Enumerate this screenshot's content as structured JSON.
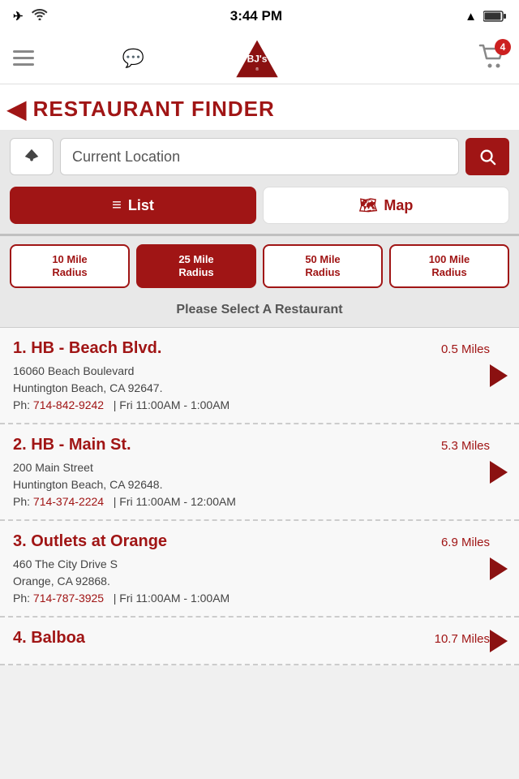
{
  "status": {
    "time": "3:44 PM",
    "battery_label": "🔋",
    "signal": "▲"
  },
  "nav": {
    "menu_label": "Menu",
    "chat_label": "Messages",
    "cart_badge": "4",
    "logo_alt": "BJ's Restaurant"
  },
  "header": {
    "back_label": "◀",
    "title": "RESTAURANT FINDER"
  },
  "search": {
    "location_placeholder": "Current Location",
    "location_value": "Current Location",
    "search_icon": "🔍"
  },
  "tabs": [
    {
      "id": "list",
      "label": "List",
      "icon": "≡",
      "active": true
    },
    {
      "id": "map",
      "label": "Map",
      "icon": "🗺",
      "active": false
    }
  ],
  "radius_options": [
    {
      "label": "10 Mile\nRadius",
      "value": "10",
      "active": false
    },
    {
      "label": "25 Mile\nRadius",
      "value": "25",
      "active": true
    },
    {
      "label": "50 Mile\nRadius",
      "value": "50",
      "active": false
    },
    {
      "label": "100 Mile\nRadius",
      "value": "100",
      "active": false
    }
  ],
  "select_prompt": "Please Select A Restaurant",
  "restaurants": [
    {
      "number": "1.",
      "name": "HB - Beach Blvd.",
      "distance": "0.5 Miles",
      "address_line1": "16060 Beach Boulevard",
      "address_line2": "Huntington Beach, CA 92647.",
      "phone": "714-842-9242",
      "hours": "Fri 11:00AM - 1:00AM"
    },
    {
      "number": "2.",
      "name": "HB - Main St.",
      "distance": "5.3 Miles",
      "address_line1": "200 Main Street",
      "address_line2": "Huntington Beach, CA 92648.",
      "phone": "714-374-2224",
      "hours": "Fri 11:00AM - 12:00AM"
    },
    {
      "number": "3.",
      "name": "Outlets at Orange",
      "distance": "6.9 Miles",
      "address_line1": "460 The City Drive S",
      "address_line2": "Orange, CA 92868.",
      "phone": "714-787-3925",
      "hours": "Fri 11:00AM - 1:00AM"
    },
    {
      "number": "4.",
      "name": "Balboa",
      "distance": "10.7 Miles",
      "address_line1": "",
      "address_line2": "",
      "phone": "",
      "hours": ""
    }
  ]
}
